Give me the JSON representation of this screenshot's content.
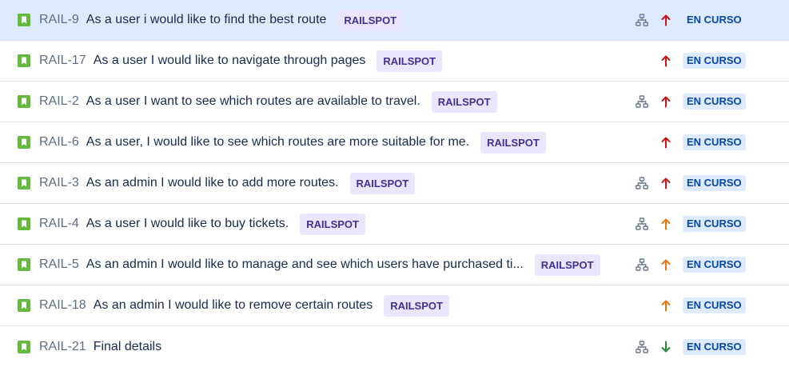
{
  "colors": {
    "story_green": "#63ba3c",
    "selected_row": "#deebff",
    "epic_bg": "#eae6ff",
    "epic_text": "#403294",
    "status_bg": "#deebff",
    "status_text": "#0747a6",
    "priority_highest": "#cd1317",
    "priority_high": "#e9730c",
    "priority_low": "#2a8735"
  },
  "issues": [
    {
      "key": "RAIL-9",
      "summary": "As a user i would like to find the best route",
      "epic": "RAILSPOT",
      "has_children": true,
      "priority": "highest",
      "status": "EN CURSO",
      "selected": true
    },
    {
      "key": "RAIL-17",
      "summary": "As a user I would like to navigate through pages",
      "epic": "RAILSPOT",
      "has_children": false,
      "priority": "highest",
      "status": "EN CURSO"
    },
    {
      "key": "RAIL-2",
      "summary": "As a user I want to see which routes are available to travel.",
      "epic": "RAILSPOT",
      "has_children": true,
      "priority": "highest",
      "status": "EN CURSO"
    },
    {
      "key": "RAIL-6",
      "summary": "As a user, I would like to see which routes are more suitable for me.",
      "epic": "RAILSPOT",
      "has_children": false,
      "priority": "highest",
      "status": "EN CURSO"
    },
    {
      "key": "RAIL-3",
      "summary": "As an admin I would like to add more routes.",
      "epic": "RAILSPOT",
      "has_children": true,
      "priority": "highest",
      "status": "EN CURSO"
    },
    {
      "key": "RAIL-4",
      "summary": "As a user I would like to buy tickets.",
      "epic": "RAILSPOT",
      "has_children": true,
      "priority": "high",
      "status": "EN CURSO"
    },
    {
      "key": "RAIL-5",
      "summary": "As an admin I would like to manage and see which users have purchased ti...",
      "epic": "RAILSPOT",
      "has_children": true,
      "priority": "high",
      "status": "EN CURSO"
    },
    {
      "key": "RAIL-18",
      "summary": "As an admin I would like to remove certain routes",
      "epic": "RAILSPOT",
      "has_children": false,
      "priority": "high",
      "status": "EN CURSO"
    },
    {
      "key": "RAIL-21",
      "summary": "Final details",
      "epic": "",
      "has_children": true,
      "priority": "low",
      "status": "EN CURSO"
    }
  ]
}
